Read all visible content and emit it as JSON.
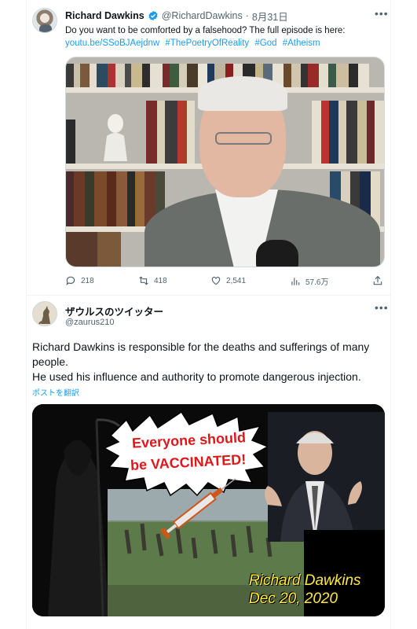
{
  "tweet1": {
    "author_name": "Richard Dawkins",
    "author_handle": "@RichardDawkins",
    "separator": "·",
    "date": "8月31日",
    "more_icon": "more-horizontal-icon",
    "text": "Do you want to be comforted by a falsehood? The full episode is here:",
    "link": "youtu.be/SSoBJAejdnw",
    "hashtags": [
      "#ThePoetryOfReality",
      "#God",
      "#Atheism"
    ],
    "media": "video-thumbnail",
    "actions": {
      "replies": "218",
      "reposts": "418",
      "likes": "2,541",
      "views": "57.6万"
    }
  },
  "tweet2": {
    "author_name": "ザウルスのツイッター",
    "author_handle": "@zaurus210",
    "text_lines": [
      "Richard Dawkins is responsible for the deaths and sufferings of many people.",
      "He used his influence and authority to promote dangerous injection."
    ],
    "translate_label": "ポストを翻訳",
    "media": {
      "bubble_line1": "Everyone should",
      "bubble_line2": "be VACCINATED!",
      "caption_name": "Richard Dawkins",
      "caption_date": "Dec 20, 2020"
    }
  },
  "colors": {
    "link": "#1d9bf0",
    "secondary_text": "#536471",
    "primary_text": "#0f1419",
    "bubble_text": "#e0161a",
    "caption_text": "#ffe93a"
  }
}
